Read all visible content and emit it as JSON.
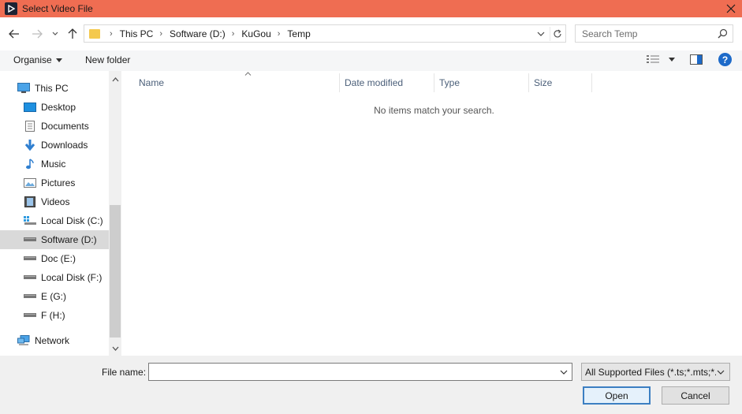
{
  "window": {
    "title": "Select Video File",
    "app_icon": "app-play-icon",
    "close_icon": "close-icon"
  },
  "address": {
    "crumbs": [
      "This PC",
      "Software (D:)",
      "KuGou",
      "Temp"
    ]
  },
  "search": {
    "placeholder": "Search Temp"
  },
  "toolbar": {
    "organise_label": "Organise",
    "new_folder_label": "New folder",
    "help_label": "?"
  },
  "nav": {
    "items": [
      {
        "label": "This PC",
        "icon": "this-pc-icon"
      },
      {
        "label": "Desktop",
        "icon": "desktop-icon"
      },
      {
        "label": "Documents",
        "icon": "documents-icon"
      },
      {
        "label": "Downloads",
        "icon": "downloads-icon"
      },
      {
        "label": "Music",
        "icon": "music-icon"
      },
      {
        "label": "Pictures",
        "icon": "pictures-icon"
      },
      {
        "label": "Videos",
        "icon": "videos-icon"
      },
      {
        "label": "Local Disk (C:)",
        "icon": "system-drive-icon"
      },
      {
        "label": "Software (D:)",
        "icon": "drive-icon",
        "selected": true
      },
      {
        "label": "Doc (E:)",
        "icon": "drive-icon"
      },
      {
        "label": "Local Disk (F:)",
        "icon": "drive-icon"
      },
      {
        "label": "E (G:)",
        "icon": "drive-icon"
      },
      {
        "label": "F (H:)",
        "icon": "drive-icon"
      },
      {
        "label": "Network",
        "icon": "network-icon"
      }
    ]
  },
  "filelist": {
    "columns": [
      "Name",
      "Date modified",
      "Type",
      "Size"
    ],
    "empty_message": "No items match your search."
  },
  "footer": {
    "file_name_label": "File name:",
    "file_name_value": "",
    "filter_selected": "All Supported Files (*.ts;*.mts;*.",
    "open_label": "Open",
    "cancel_label": "Cancel"
  },
  "colors": {
    "titlebar": "#ef6d52",
    "accent": "#1d6ac9",
    "selected_nav": "#d9d9d9"
  }
}
